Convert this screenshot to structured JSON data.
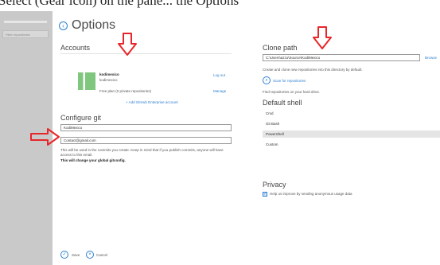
{
  "top_cut_text": "Select (Gear icon) on the pane... the Options",
  "sidebar": {
    "filter_placeholder": "Filter repositories"
  },
  "page": {
    "title": "Options",
    "accounts": {
      "heading": "Accounts",
      "username": "kodimexico",
      "login": "kodimexico",
      "logout_label": "Log out",
      "plan": "Free plan (0 private repositories)",
      "manage_label": "Manage",
      "add_enterprise_label": "+ Add GitHub Enterprise account"
    },
    "git": {
      "heading": "Configure git",
      "name_value": "KodiMexico",
      "email_value": "Contact@gmail.com",
      "note": "This will be used in the commits you create. Keep in mind that if you publish commits, anyone will have access to this email.",
      "note_bold": "This will change your global gitconfig."
    },
    "clone": {
      "heading": "Clone path",
      "path_value": "C:\\Users\\azzu\\Source\\KodiMexico",
      "browse_label": "Browse",
      "description": "Create and clone new repositories into this directory by default.",
      "scan_label": "Scan for repositories",
      "scan_description": "Find repositories on your hard drive."
    },
    "shell": {
      "heading": "Default shell",
      "options": [
        "Cmd",
        "Git Bash",
        "PowerShell",
        "Custom"
      ],
      "selected": "PowerShell"
    },
    "privacy": {
      "heading": "Privacy",
      "checkbox_label": "Help us improve by sending anonymous usage data"
    },
    "footer": {
      "save_label": "Save",
      "cancel_label": "Cancel"
    }
  },
  "annotation_color": "#e8262a"
}
